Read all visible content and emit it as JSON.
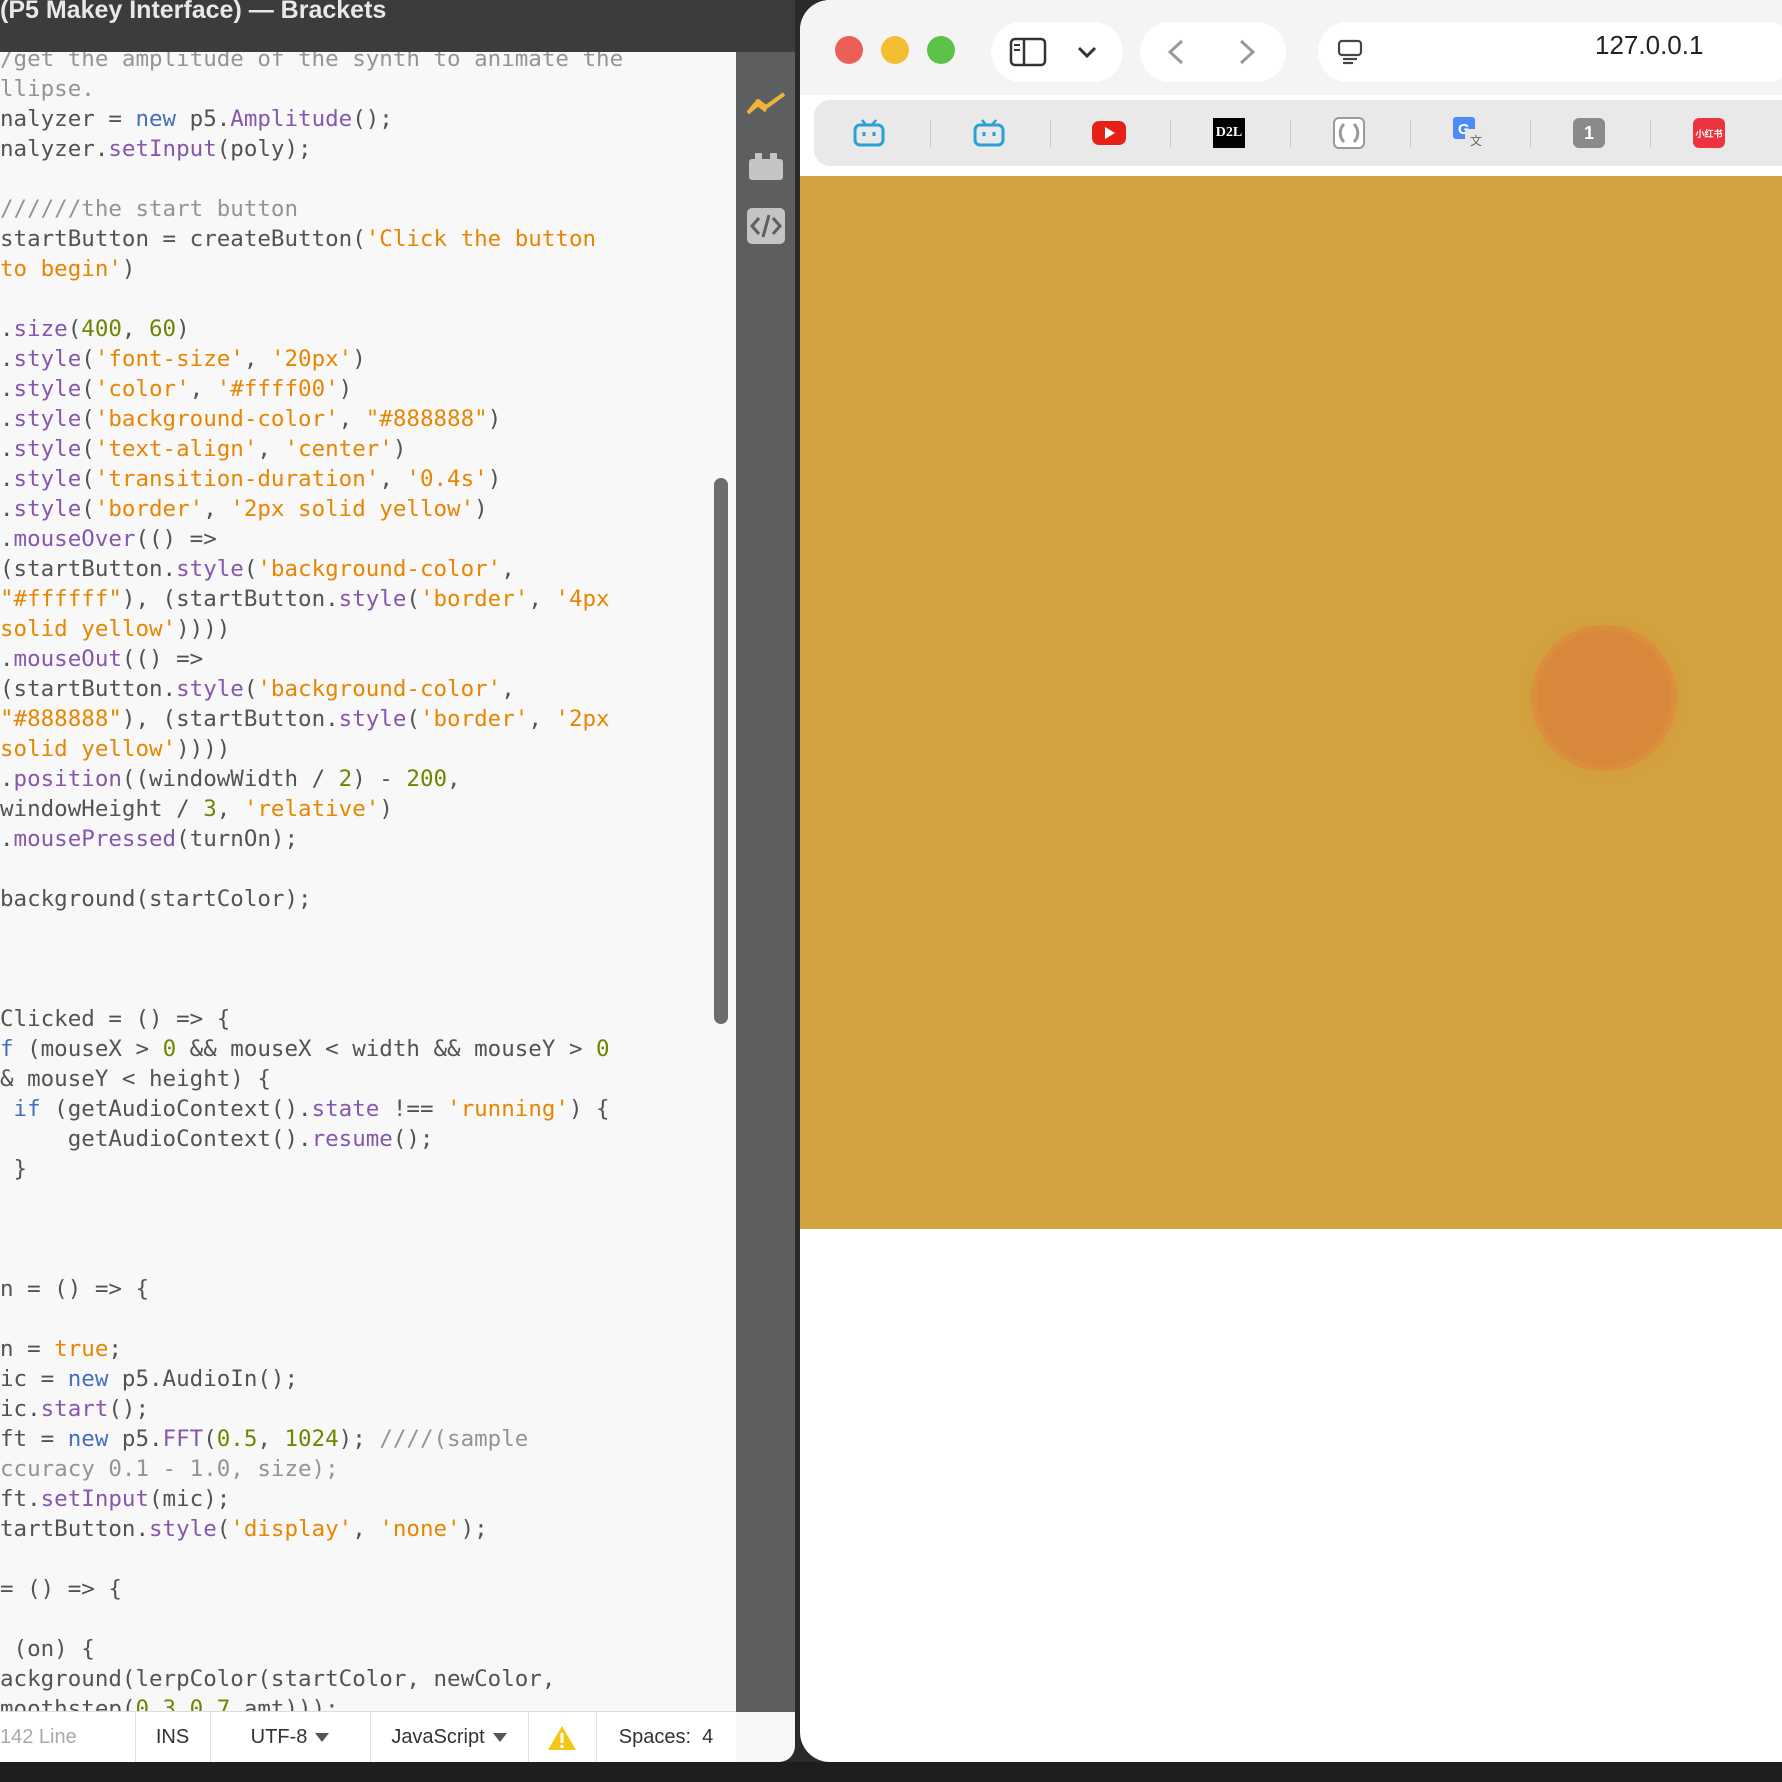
{
  "editor": {
    "title": "(P5 Makey Interface) — Brackets",
    "code_lines": [
      [
        [
          "cm",
          "/get the amplitude of the synth to animate the"
        ]
      ],
      [
        [
          "cm",
          "llipse."
        ]
      ],
      [
        [
          "",
          "nalyzer = "
        ],
        [
          "kw",
          "new"
        ],
        [
          "",
          " p5."
        ],
        [
          "pr",
          "Amplitude"
        ],
        [
          "",
          "();"
        ]
      ],
      [
        [
          "",
          "nalyzer."
        ],
        [
          "pr",
          "setInput"
        ],
        [
          "",
          "(poly);"
        ]
      ],
      [
        [
          "",
          ""
        ]
      ],
      [
        [
          "cm",
          "//////the start button"
        ]
      ],
      [
        [
          "",
          "startButton = createButton("
        ],
        [
          "st",
          "'Click the button"
        ]
      ],
      [
        [
          "st",
          "to begin'"
        ],
        [
          "",
          ")"
        ]
      ],
      [
        [
          "",
          ""
        ]
      ],
      [
        [
          "",
          "."
        ],
        [
          "pr",
          "size"
        ],
        [
          "",
          "("
        ],
        [
          "nm",
          "400"
        ],
        [
          "",
          ", "
        ],
        [
          "nm",
          "60"
        ],
        [
          "",
          ")"
        ]
      ],
      [
        [
          "",
          "."
        ],
        [
          "pr",
          "style"
        ],
        [
          "",
          "("
        ],
        [
          "st",
          "'font-size'"
        ],
        [
          "",
          ", "
        ],
        [
          "st",
          "'20px'"
        ],
        [
          "",
          ")"
        ]
      ],
      [
        [
          "",
          "."
        ],
        [
          "pr",
          "style"
        ],
        [
          "",
          "("
        ],
        [
          "st",
          "'color'"
        ],
        [
          "",
          ", "
        ],
        [
          "st",
          "'#ffff00'"
        ],
        [
          "",
          ")"
        ]
      ],
      [
        [
          "",
          "."
        ],
        [
          "pr",
          "style"
        ],
        [
          "",
          "("
        ],
        [
          "st",
          "'background-color'"
        ],
        [
          "",
          ", "
        ],
        [
          "st",
          "\"#888888\""
        ],
        [
          "",
          ")"
        ]
      ],
      [
        [
          "",
          "."
        ],
        [
          "pr",
          "style"
        ],
        [
          "",
          "("
        ],
        [
          "st",
          "'text-align'"
        ],
        [
          "",
          ", "
        ],
        [
          "st",
          "'center'"
        ],
        [
          "",
          ")"
        ]
      ],
      [
        [
          "",
          "."
        ],
        [
          "pr",
          "style"
        ],
        [
          "",
          "("
        ],
        [
          "st",
          "'transition-duration'"
        ],
        [
          "",
          ", "
        ],
        [
          "st",
          "'0.4s'"
        ],
        [
          "",
          ")"
        ]
      ],
      [
        [
          "",
          "."
        ],
        [
          "pr",
          "style"
        ],
        [
          "",
          "("
        ],
        [
          "st",
          "'border'"
        ],
        [
          "",
          ", "
        ],
        [
          "st",
          "'2px solid yellow'"
        ],
        [
          "",
          ")"
        ]
      ],
      [
        [
          "",
          "."
        ],
        [
          "pr",
          "mouseOver"
        ],
        [
          "",
          "(() =>"
        ]
      ],
      [
        [
          "",
          "(startButton."
        ],
        [
          "pr",
          "style"
        ],
        [
          "",
          "("
        ],
        [
          "st",
          "'background-color'"
        ],
        [
          "",
          ","
        ]
      ],
      [
        [
          "st",
          "\"#ffffff\""
        ],
        [
          "",
          "), (startButton."
        ],
        [
          "pr",
          "style"
        ],
        [
          "",
          "("
        ],
        [
          "st",
          "'border'"
        ],
        [
          "",
          ", "
        ],
        [
          "st",
          "'4px"
        ]
      ],
      [
        [
          "st",
          "solid yellow'"
        ],
        [
          "",
          "))))"
        ]
      ],
      [
        [
          "",
          "."
        ],
        [
          "pr",
          "mouseOut"
        ],
        [
          "",
          "(() =>"
        ]
      ],
      [
        [
          "",
          "(startButton."
        ],
        [
          "pr",
          "style"
        ],
        [
          "",
          "("
        ],
        [
          "st",
          "'background-color'"
        ],
        [
          "",
          ","
        ]
      ],
      [
        [
          "st",
          "\"#888888\""
        ],
        [
          "",
          "), (startButton."
        ],
        [
          "pr",
          "style"
        ],
        [
          "",
          "("
        ],
        [
          "st",
          "'border'"
        ],
        [
          "",
          ", "
        ],
        [
          "st",
          "'2px"
        ]
      ],
      [
        [
          "st",
          "solid yellow'"
        ],
        [
          "",
          "))))"
        ]
      ],
      [
        [
          "",
          "."
        ],
        [
          "pr",
          "position"
        ],
        [
          "",
          "((windowWidth / "
        ],
        [
          "nm",
          "2"
        ],
        [
          "",
          ") - "
        ],
        [
          "nm",
          "200"
        ],
        [
          "",
          ","
        ]
      ],
      [
        [
          "",
          "windowHeight / "
        ],
        [
          "nm",
          "3"
        ],
        [
          "",
          ", "
        ],
        [
          "st",
          "'relative'"
        ],
        [
          "",
          ")"
        ]
      ],
      [
        [
          "",
          "."
        ],
        [
          "pr",
          "mousePressed"
        ],
        [
          "",
          "(turnOn);"
        ]
      ],
      [
        [
          "",
          ""
        ]
      ],
      [
        [
          "",
          "background(startColor);"
        ]
      ],
      [
        [
          "",
          ""
        ]
      ],
      [
        [
          "",
          ""
        ]
      ],
      [
        [
          "",
          ""
        ]
      ],
      [
        [
          "",
          "Clicked = () => {"
        ]
      ],
      [
        [
          "kw",
          "f"
        ],
        [
          "",
          " (mouseX > "
        ],
        [
          "nm",
          "0"
        ],
        [
          "",
          " && mouseX < width && mouseY > "
        ],
        [
          "nm",
          "0"
        ]
      ],
      [
        [
          "",
          "& mouseY < height) {"
        ]
      ],
      [
        [
          "",
          " "
        ],
        [
          "kw",
          "if"
        ],
        [
          "",
          " (getAudioContext()."
        ],
        [
          "pr",
          "state"
        ],
        [
          "",
          " !== "
        ],
        [
          "st",
          "'running'"
        ],
        [
          "",
          ") {"
        ]
      ],
      [
        [
          "",
          "     getAudioContext()."
        ],
        [
          "pr",
          "resume"
        ],
        [
          "",
          "();"
        ]
      ],
      [
        [
          "",
          " }"
        ]
      ],
      [
        [
          "",
          ""
        ]
      ],
      [
        [
          "",
          ""
        ]
      ],
      [
        [
          "",
          ""
        ]
      ],
      [
        [
          "",
          "n = () => {"
        ]
      ],
      [
        [
          "",
          ""
        ]
      ],
      [
        [
          "",
          "n = "
        ],
        [
          "st",
          "true"
        ],
        [
          "",
          ";"
        ]
      ],
      [
        [
          "",
          "ic = "
        ],
        [
          "kw",
          "new"
        ],
        [
          "",
          " p5.AudioIn();"
        ]
      ],
      [
        [
          "",
          "ic."
        ],
        [
          "pr",
          "start"
        ],
        [
          "",
          "();"
        ]
      ],
      [
        [
          "",
          "ft = "
        ],
        [
          "kw",
          "new"
        ],
        [
          "",
          " p5."
        ],
        [
          "pr",
          "FFT"
        ],
        [
          "",
          "("
        ],
        [
          "nm",
          "0.5"
        ],
        [
          "",
          ", "
        ],
        [
          "nm",
          "1024"
        ],
        [
          "",
          "); "
        ],
        [
          "cm",
          "////(sample"
        ]
      ],
      [
        [
          "cm",
          "ccuracy 0.1 - 1.0, size);"
        ]
      ],
      [
        [
          "",
          "ft."
        ],
        [
          "pr",
          "setInput"
        ],
        [
          "",
          "(mic);"
        ]
      ],
      [
        [
          "",
          "tartButton."
        ],
        [
          "pr",
          "style"
        ],
        [
          "",
          "("
        ],
        [
          "st",
          "'display'"
        ],
        [
          "",
          ", "
        ],
        [
          "st",
          "'none'"
        ],
        [
          "",
          ");"
        ]
      ],
      [
        [
          "",
          ""
        ]
      ],
      [
        [
          "",
          "= () => {"
        ]
      ],
      [
        [
          "",
          ""
        ]
      ],
      [
        [
          "",
          " (on) {"
        ]
      ],
      [
        [
          "",
          "ackground(lerpColor(startColor, newColor,"
        ]
      ],
      [
        [
          "",
          "moothstep("
        ],
        [
          "nm",
          "0.3"
        ],
        [
          "",
          ","
        ],
        [
          "nm",
          "0.7"
        ],
        [
          "",
          ",amt)));"
        ]
      ]
    ],
    "status": {
      "lines": "142 Line",
      "mode": "INS",
      "encoding": "UTF-8",
      "language": "JavaScript",
      "spaces_label": "Spaces:",
      "spaces_value": "4"
    },
    "toolbar_icons": [
      "live-preview-icon",
      "extensions-icon",
      "code-tags-icon"
    ]
  },
  "browser": {
    "url": "127.0.0.1",
    "bookmarks": [
      {
        "icon": "bilibili-icon",
        "color": "#2aa0d8"
      },
      {
        "icon": "bilibili-icon",
        "color": "#2aa0d8"
      },
      {
        "icon": "youtube-icon",
        "color": "#e62117"
      },
      {
        "icon": "d2l-icon",
        "label": "D2L",
        "color": "#000000"
      },
      {
        "icon": "notes-icon",
        "color": "#9a9a9a"
      },
      {
        "icon": "google-translate-icon",
        "color": "#4c8bf5"
      },
      {
        "icon": "number-one-icon",
        "label": "1",
        "color": "#8a8a8a"
      },
      {
        "icon": "xiaohongshu-icon",
        "label": "小红书",
        "color": "#ec3340"
      }
    ],
    "canvas_color": "#d3a33f",
    "orb_color": "#d7883a"
  }
}
